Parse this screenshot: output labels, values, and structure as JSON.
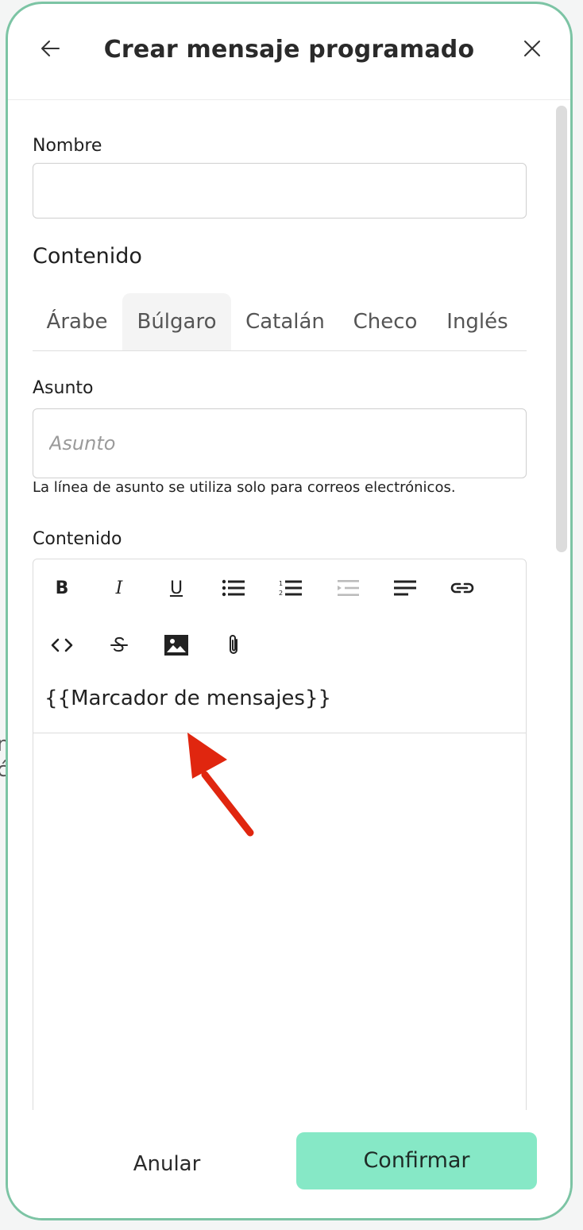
{
  "background": {
    "fragment_1": "n",
    "fragment_2": "ć"
  },
  "header": {
    "title": "Crear mensaje programado",
    "back_icon": "arrow-left-icon",
    "close_icon": "close-icon"
  },
  "form": {
    "name_label": "Nombre",
    "name_value": "",
    "content_section_title": "Contenido",
    "tabs": [
      {
        "label": "Árabe",
        "active": false
      },
      {
        "label": "Búlgaro",
        "active": true
      },
      {
        "label": "Catalán",
        "active": false
      },
      {
        "label": "Checo",
        "active": false
      },
      {
        "label": "Inglés",
        "active": false
      }
    ],
    "subject_label": "Asunto",
    "subject_placeholder": "Asunto",
    "subject_help": "La línea de asunto se utiliza solo para correos electrónicos.",
    "content_label": "Contenido",
    "editor": {
      "toolbar": [
        "bold-icon",
        "italic-icon",
        "underline-icon",
        "bullet-list-icon",
        "numbered-list-icon",
        "indent-icon",
        "align-left-icon",
        "link-icon",
        "code-icon",
        "strikethrough-icon",
        "image-icon",
        "attachment-icon"
      ],
      "bold_glyph": "B",
      "italic_glyph": "I",
      "underline_glyph": "U",
      "content": "{{Marcador de mensajes}}"
    }
  },
  "footer": {
    "cancel_label": "Anular",
    "confirm_label": "Confirmar"
  },
  "colors": {
    "accent": "#86e8c6",
    "modal_border": "#7cc4a4",
    "annotation_arrow": "#e0260f"
  }
}
